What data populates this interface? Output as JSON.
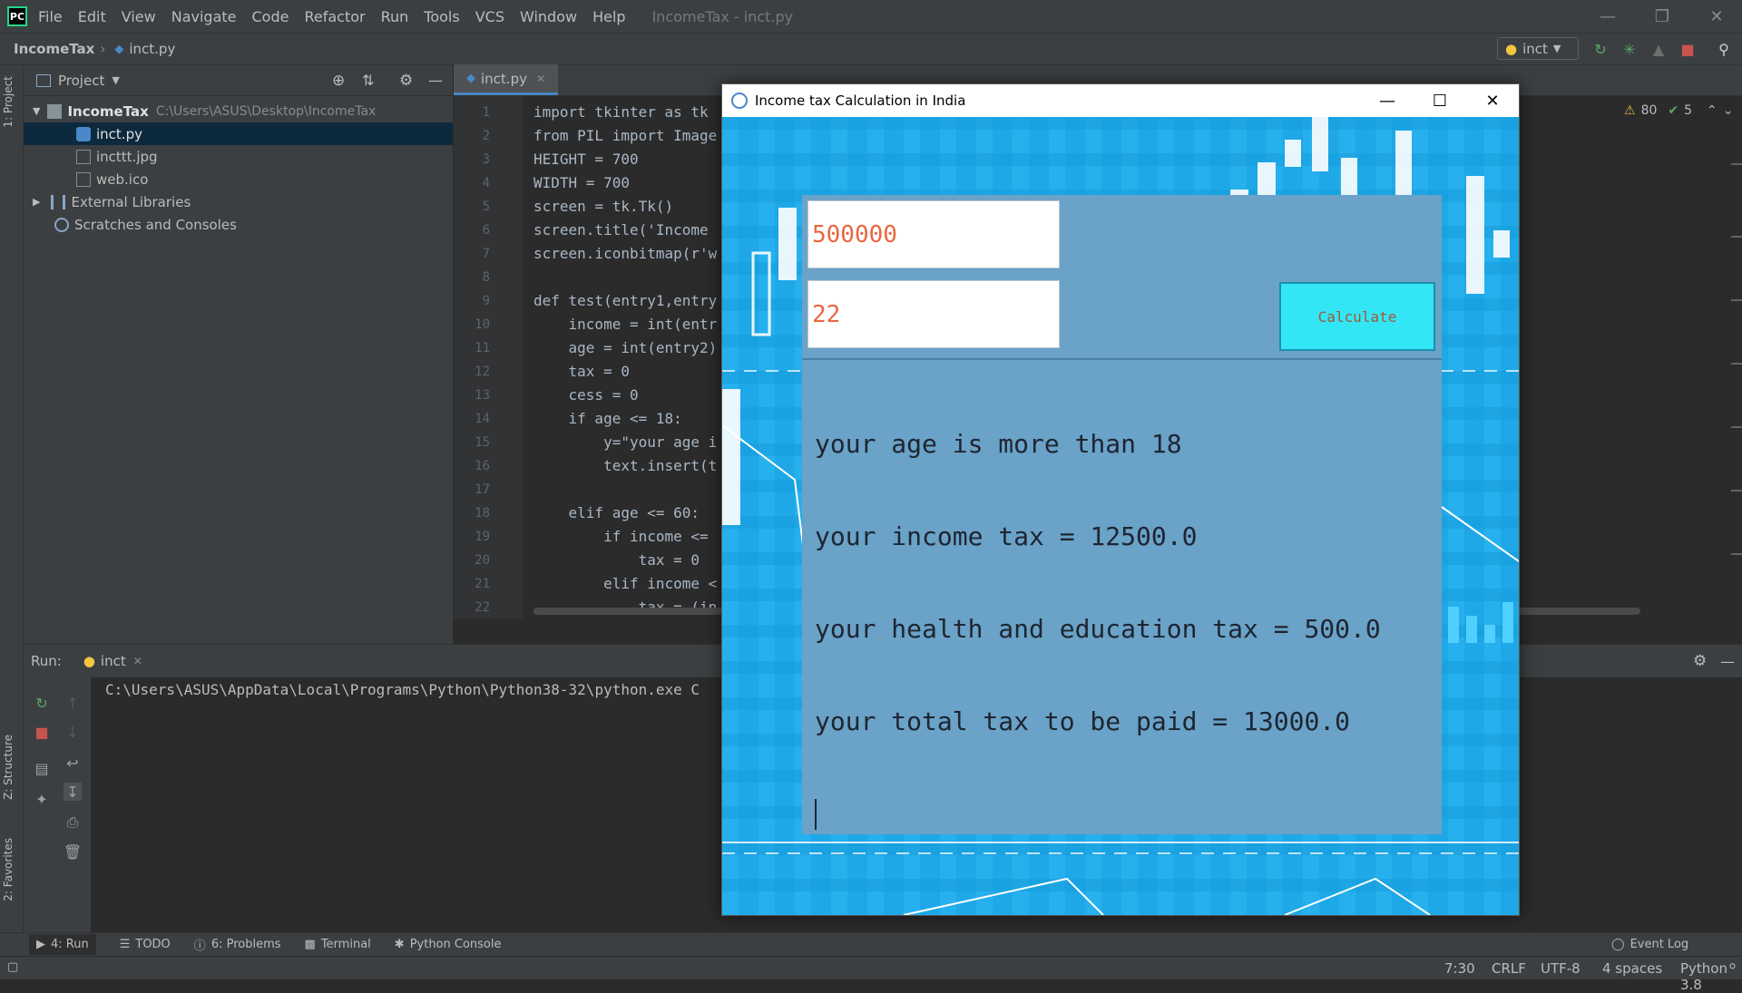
{
  "menubar": {
    "logo": "PC",
    "items": [
      "File",
      "Edit",
      "View",
      "Navigate",
      "Code",
      "Refactor",
      "Run",
      "Tools",
      "VCS",
      "Window",
      "Help"
    ],
    "window_title": "IncomeTax - inct.py"
  },
  "navbar": {
    "project": "IncomeTax",
    "file": "inct.py",
    "run_config": "inct"
  },
  "sidestrip": {
    "project_tab": "1: Project",
    "structure_tab": "Z: Structure",
    "favorites_tab": "2: Favorites"
  },
  "project_panel": {
    "title": "Project",
    "root": {
      "name": "IncomeTax",
      "path": "C:\\Users\\ASUS\\Desktop\\IncomeTax"
    },
    "files": [
      "inct.py",
      "incttt.jpg",
      "web.ico"
    ],
    "external_libraries": "External Libraries",
    "scratches": "Scratches and Consoles"
  },
  "editor": {
    "tab": "inct.py",
    "inspection_warnings": "80",
    "inspection_ok": "5",
    "line_numbers": [
      "1",
      "2",
      "3",
      "4",
      "5",
      "6",
      "7",
      "8",
      "9",
      "10",
      "11",
      "12",
      "13",
      "14",
      "15",
      "16",
      "17",
      "18",
      "19",
      "20",
      "21",
      "22"
    ],
    "lines": [
      "import tkinter as tk",
      "from PIL import Image",
      "HEIGHT = 700",
      "WIDTH = 700",
      "screen = tk.Tk()",
      "screen.title('Income",
      "screen.iconbitmap(r'w",
      "",
      "def test(entry1,entry",
      "    income = int(entr",
      "    age = int(entry2)",
      "    tax = 0",
      "    cess = 0",
      "    if age <= 18:",
      "        y=\"your age i",
      "        text.insert(t",
      "",
      "    elif age <= 60:",
      "        if income <=",
      "            tax = 0",
      "        elif income <",
      "            tax = (in"
    ]
  },
  "run_panel": {
    "label": "Run:",
    "tab": "inct",
    "console_line": "C:\\Users\\ASUS\\AppData\\Local\\Programs\\Python\\Python38-32\\python.exe C"
  },
  "bottom_tabs": {
    "run": "4: Run",
    "todo": "TODO",
    "problems": "6: Problems",
    "terminal": "Terminal",
    "python_console": "Python Console",
    "event_log": "Event Log"
  },
  "status_bar": {
    "position": "7:30",
    "line_sep": "CRLF",
    "encoding": "UTF-8",
    "indent": "4 spaces",
    "interpreter": "Python 3.8"
  },
  "tk_window": {
    "title": "Income tax Calculation in India",
    "income_value": "500000",
    "age_value": "22",
    "calculate_label": "Calculate",
    "output_lines": [
      "your age is more than 18",
      "your income tax = 12500.0",
      "your health and education tax = 500.0",
      "your total tax to be paid = 13000.0"
    ]
  },
  "colors": {
    "ide_bg": "#2b2b2b",
    "ide_panel": "#3c3f41",
    "tk_bg": "#1ea8e8",
    "tk_panel": "#6aa2c8",
    "calc_button": "#33e6f5",
    "entry_text": "#e8673f"
  }
}
